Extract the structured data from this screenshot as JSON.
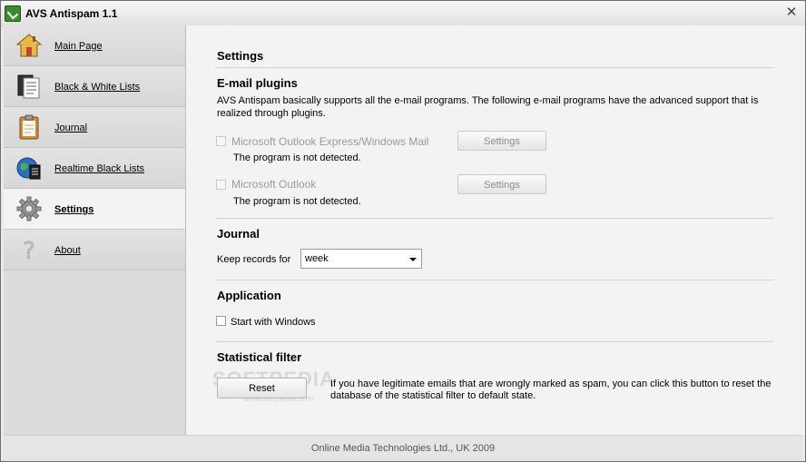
{
  "window": {
    "title": "AVS Antispam 1.1",
    "close_glyph": "✕"
  },
  "sidebar": {
    "items": [
      {
        "label": "Main Page",
        "icon": "home-icon"
      },
      {
        "label": "Black & White Lists",
        "icon": "list-document-icon"
      },
      {
        "label": "Journal",
        "icon": "clipboard-icon"
      },
      {
        "label": "Realtime Black Lists",
        "icon": "globe-document-icon"
      },
      {
        "label": "Settings",
        "icon": "gear-icon",
        "active": true
      },
      {
        "label": "About",
        "icon": "question-icon"
      }
    ]
  },
  "main": {
    "title": "Settings",
    "plugins": {
      "heading": "E-mail plugins",
      "description_line1": "AVS Antispam basically supports all the e-mail programs. The following e-mail programs have the advanced support that is",
      "description_line2": "realized through plugins.",
      "items": [
        {
          "label": "Microsoft Outlook Express/Windows Mail",
          "status": "The program is not detected.",
          "button": "Settings"
        },
        {
          "label": "Microsoft Outlook",
          "status": "The program is not detected.",
          "button": "Settings"
        }
      ]
    },
    "journal": {
      "heading": "Journal",
      "keep_label": "Keep records for",
      "keep_value": "week"
    },
    "application": {
      "heading": "Application",
      "start_label": "Start with Windows",
      "start_checked": false
    },
    "statistical": {
      "heading": "Statistical filter",
      "reset_label": "Reset",
      "description_line1": "If you have legitimate emails that are wrongly marked as spam, you can click this button to reset the",
      "description_line2": "database of the statistical filter to default state."
    },
    "watermark": {
      "text": "SOFTPEDIA",
      "small": "www.softpedia.com"
    }
  },
  "footer": {
    "text": "Online Media Technologies Ltd., UK 2009"
  },
  "colors": {
    "sidebar_bg": "#dcdcdc",
    "content_bg": "#f3f3f3",
    "accent_icon": "#3f8a2f"
  }
}
